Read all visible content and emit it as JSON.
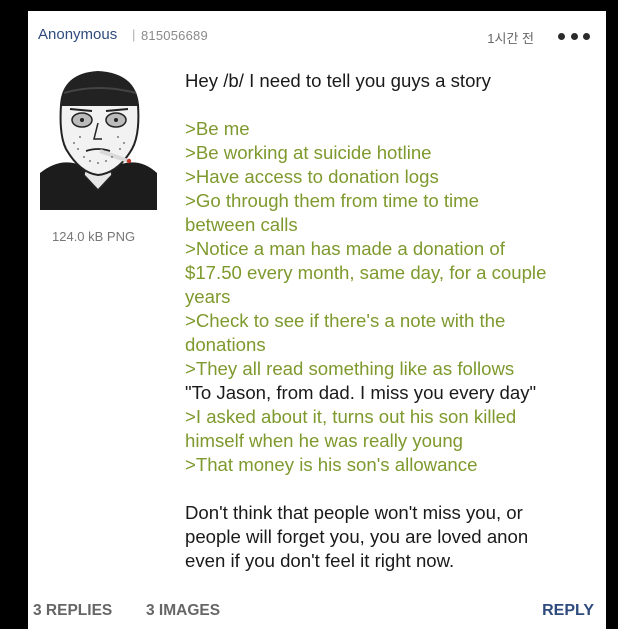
{
  "post": {
    "poster_name": "Anonymous",
    "separator": "|",
    "post_id": "815056689",
    "time_ago": "1시간 전",
    "file_size": "124.0 kB PNG",
    "body_lines": [
      {
        "text": "Hey /b/ I need to tell you guys a story",
        "green": false
      },
      {
        "text": "",
        "green": false
      },
      {
        "text": ">Be me",
        "green": true
      },
      {
        "text": ">Be working at suicide hotline",
        "green": true
      },
      {
        "text": ">Have access to donation logs",
        "green": true
      },
      {
        "text": ">Go through them from time to time",
        "green": true
      },
      {
        "text": "between calls",
        "green": true
      },
      {
        "text": ">Notice a man has made a donation of",
        "green": true
      },
      {
        "text": "$17.50 every month, same day, for a couple",
        "green": true
      },
      {
        "text": "years",
        "green": true
      },
      {
        "text": ">Check to see if there's a note with the",
        "green": true
      },
      {
        "text": "donations",
        "green": true
      },
      {
        "text": ">They all read something like as follows",
        "green": true
      },
      {
        "text": "\"To Jason, from dad. I miss you every day\"",
        "green": false
      },
      {
        "text": ">I asked about it, turns out his son killed",
        "green": true
      },
      {
        "text": "himself when he was really young",
        "green": true
      },
      {
        "text": ">That money is his son's allowance",
        "green": true
      },
      {
        "text": "",
        "green": false
      },
      {
        "text": "Don't think that people won't miss you, or",
        "green": false
      },
      {
        "text": "people will forget you, you are loved anon",
        "green": false
      },
      {
        "text": "even if you don't feel it right now.",
        "green": false
      }
    ]
  },
  "footer": {
    "replies": "3 REPLIES",
    "images": "3 IMAGES",
    "reply_button": "REPLY"
  },
  "colors": {
    "greentext": "#7e9a2e",
    "name": "#2f4b7d",
    "background": "#000000"
  },
  "icons": {
    "more": "more-dots-icon",
    "like": "heart-icon"
  }
}
